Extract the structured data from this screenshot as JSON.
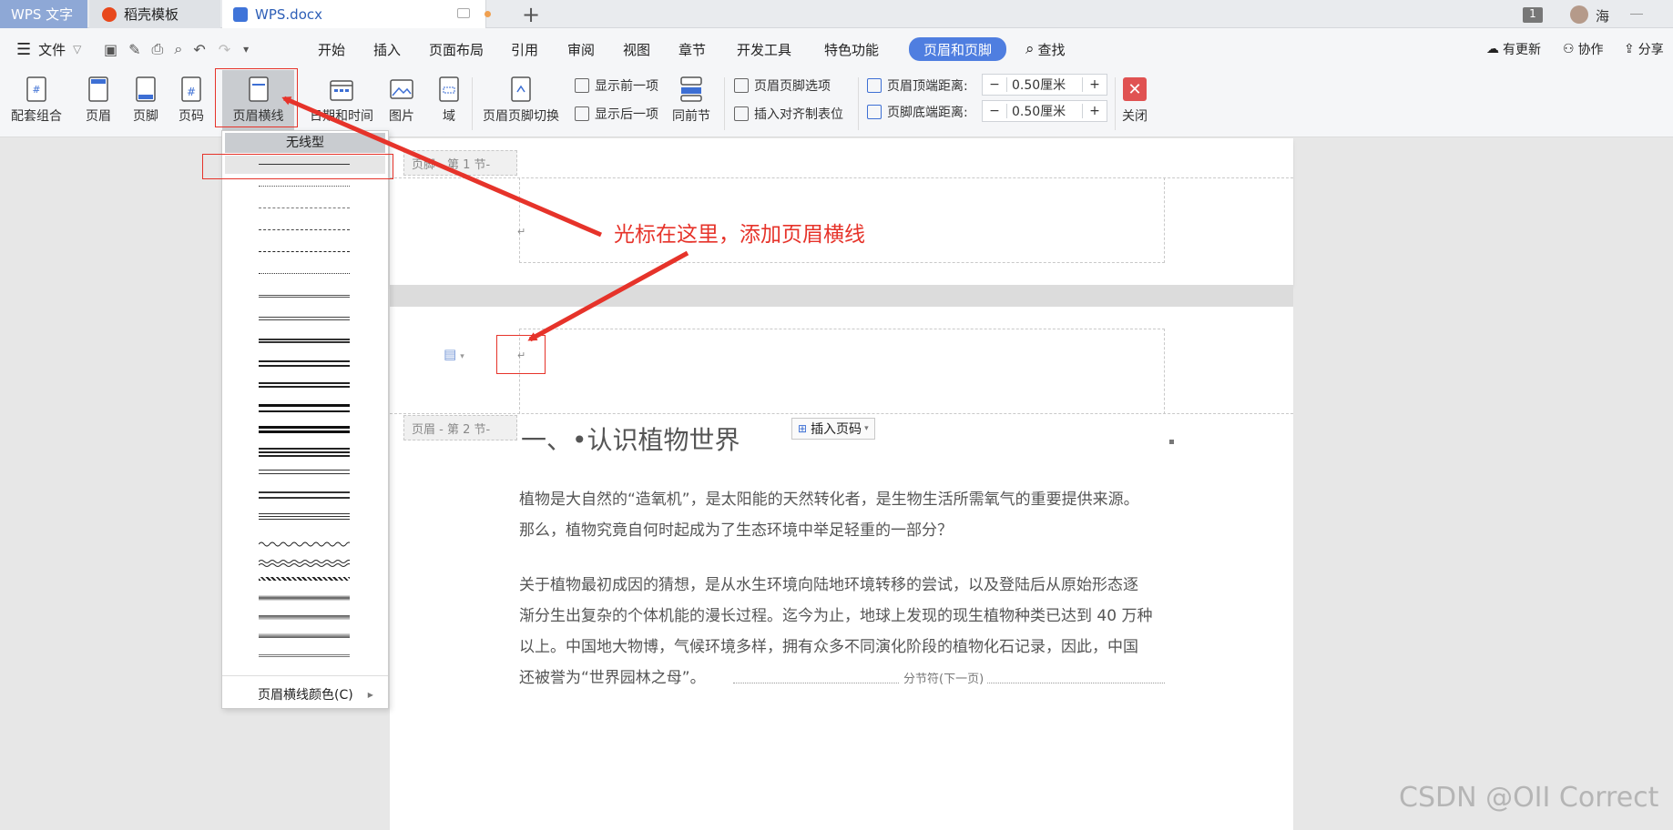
{
  "tabs": {
    "app": "WPS 文字",
    "template": "稻壳模板",
    "document": "WPS.docx",
    "badge": "1",
    "user": "海"
  },
  "menu": {
    "file": "文件",
    "items": [
      "开始",
      "插入",
      "页面布局",
      "引用",
      "审阅",
      "视图",
      "章节",
      "开发工具",
      "特色功能"
    ],
    "active": "页眉和页脚",
    "search": "查找",
    "update": "有更新",
    "collab": "协作",
    "share": "分享"
  },
  "ribbon": {
    "combo": "配套组合",
    "header": "页眉",
    "footer": "页脚",
    "pagenum": "页码",
    "header_line": "页眉横线",
    "datetime": "日期和时间",
    "picture": "图片",
    "field": "域",
    "switch": "页眉页脚切换",
    "show_prev": "显示前一项",
    "show_next": "显示后一项",
    "same_section": "同前节",
    "options": "页眉页脚选项",
    "insert_tab": "插入对齐制表位",
    "header_top_label": "页眉顶端距离:",
    "header_top_value": "0.50厘米",
    "footer_bottom_label": "页脚底端距离:",
    "footer_bottom_value": "0.50厘米",
    "close": "关闭"
  },
  "dropdown": {
    "none": "无线型",
    "color": "页眉横线颜色(C)"
  },
  "document": {
    "footer_tag": "页脚 - 第 1 节-",
    "header_tag": "页眉 - 第 2 节-",
    "insert_pagenum": "插入页码",
    "heading": "一、•认识植物世界",
    "para1_line1": "植物是大自然的“造氧机”，是太阳能的天然转化者，是生物生活所需氧气的重要提供来源。",
    "para1_line2": "那么，植物究竟自何时起成为了生态环境中举足轻重的一部分？",
    "para2_line1": "关于植物最初成因的猜想，是从水生环境向陆地环境转移的尝试，以及登陆后从原始形态逐",
    "para2_line2": "渐分生出复杂的个体机能的漫长过程。迄今为止，地球上发现的现生植物种类已达到 40 万种",
    "para2_line3": "以上。中国地大物博，气候环境多样，拥有众多不同演化阶段的植物化石记录，因此，中国",
    "para2_line4": "还被誉为“世界园林之母”。",
    "section_break": "分节符(下一页)"
  },
  "annotation": "光标在这里，添加页眉横线",
  "watermark": "CSDN @OII Correct",
  "colors": {
    "accent": "#4f7ee0",
    "annotation_red": "#e6332a"
  }
}
